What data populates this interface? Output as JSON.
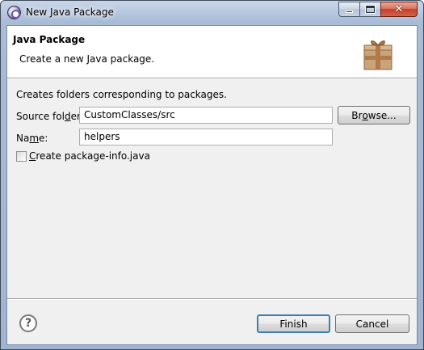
{
  "window": {
    "title": "New Java Package",
    "close_glyph": "✕"
  },
  "banner": {
    "title": "Java Package",
    "message": "Create a new Java package.",
    "icon": "package-icon"
  },
  "form": {
    "description": "Creates folders corresponding to packages.",
    "source_folder_label_pre": "Source fol",
    "source_folder_label_accel": "d",
    "source_folder_label_post": "er:",
    "source_folder_value": "CustomClasses/src",
    "browse_label_pre": "Br",
    "browse_label_accel": "o",
    "browse_label_post": "wse...",
    "name_label_pre": "Na",
    "name_label_accel": "m",
    "name_label_post": "e:",
    "name_value": "helpers",
    "package_info_checked": false,
    "package_info_label_accel": "C",
    "package_info_label_post": "reate package-info.java"
  },
  "footer": {
    "help_glyph": "?",
    "finish_label": "Finish",
    "cancel_label": "Cancel"
  }
}
